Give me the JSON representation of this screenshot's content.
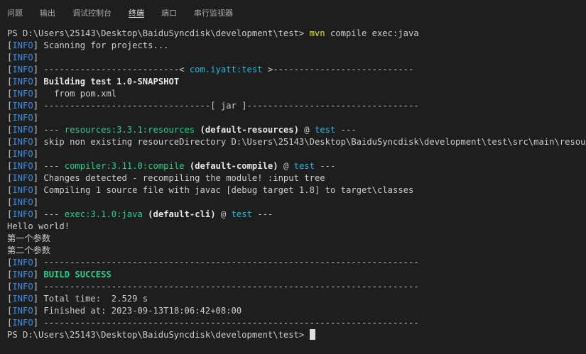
{
  "tabs": [
    {
      "label": "问题",
      "active": false
    },
    {
      "label": "输出",
      "active": false
    },
    {
      "label": "调试控制台",
      "active": false
    },
    {
      "label": "终端",
      "active": true
    },
    {
      "label": "端口",
      "active": false
    },
    {
      "label": "串行监视器",
      "active": false
    }
  ],
  "terminal": {
    "lines": [
      {
        "segments": [
          {
            "t": "PS D:\\Users\\25143\\Desktop\\BaiduSyncdisk\\development\\test> ",
            "c": ""
          },
          {
            "t": "mvn",
            "c": "yellow"
          },
          {
            "t": " compile exec:java",
            "c": ""
          }
        ]
      },
      {
        "info": true,
        "segments": [
          {
            "t": "Scanning for projects...",
            "c": ""
          }
        ]
      },
      {
        "info": true,
        "segments": []
      },
      {
        "info": true,
        "segments": [
          {
            "t": "--------------------------< ",
            "c": ""
          },
          {
            "t": "com.iyatt:test",
            "c": "cyan"
          },
          {
            "t": " >---------------------------",
            "c": ""
          }
        ]
      },
      {
        "info": true,
        "segments": [
          {
            "t": "Building test 1.0-SNAPSHOT",
            "c": "bold"
          }
        ]
      },
      {
        "info": true,
        "segments": [
          {
            "t": "  from pom.xml",
            "c": ""
          }
        ]
      },
      {
        "info": true,
        "segments": [
          {
            "t": "--------------------------------[ jar ]---------------------------------",
            "c": ""
          }
        ]
      },
      {
        "info": true,
        "segments": []
      },
      {
        "info": true,
        "segments": [
          {
            "t": "--- ",
            "c": ""
          },
          {
            "t": "resources:3.3.1:resources",
            "c": "green"
          },
          {
            "t": " ",
            "c": ""
          },
          {
            "t": "(default-resources)",
            "c": "bold"
          },
          {
            "t": " @ ",
            "c": ""
          },
          {
            "t": "test",
            "c": "cyan"
          },
          {
            "t": " ---",
            "c": ""
          }
        ]
      },
      {
        "info": true,
        "segments": [
          {
            "t": "skip non existing resourceDirectory D:\\Users\\25143\\Desktop\\BaiduSyncdisk\\development\\test\\src\\main\\resources",
            "c": ""
          }
        ]
      },
      {
        "info": true,
        "segments": []
      },
      {
        "info": true,
        "segments": [
          {
            "t": "--- ",
            "c": ""
          },
          {
            "t": "compiler:3.11.0:compile",
            "c": "green"
          },
          {
            "t": " ",
            "c": ""
          },
          {
            "t": "(default-compile)",
            "c": "bold"
          },
          {
            "t": " @ ",
            "c": ""
          },
          {
            "t": "test",
            "c": "cyan"
          },
          {
            "t": " ---",
            "c": ""
          }
        ]
      },
      {
        "info": true,
        "segments": [
          {
            "t": "Changes detected - recompiling the module! :input tree",
            "c": ""
          }
        ]
      },
      {
        "info": true,
        "segments": [
          {
            "t": "Compiling 1 source file with javac [debug target 1.8] to target\\classes",
            "c": ""
          }
        ]
      },
      {
        "info": true,
        "segments": []
      },
      {
        "info": true,
        "segments": [
          {
            "t": "--- ",
            "c": ""
          },
          {
            "t": "exec:3.1.0:java",
            "c": "green"
          },
          {
            "t": " ",
            "c": ""
          },
          {
            "t": "(default-cli)",
            "c": "bold"
          },
          {
            "t": " @ ",
            "c": ""
          },
          {
            "t": "test",
            "c": "cyan"
          },
          {
            "t": " ---",
            "c": ""
          }
        ]
      },
      {
        "segments": [
          {
            "t": "Hello world!",
            "c": ""
          }
        ]
      },
      {
        "segments": [
          {
            "t": "第一个参数",
            "c": ""
          }
        ]
      },
      {
        "segments": [
          {
            "t": "第二个参数",
            "c": ""
          }
        ]
      },
      {
        "info": true,
        "segments": [
          {
            "t": "------------------------------------------------------------------------",
            "c": ""
          }
        ]
      },
      {
        "info": true,
        "segments": [
          {
            "t": "BUILD SUCCESS",
            "c": "bold-green"
          }
        ]
      },
      {
        "info": true,
        "segments": [
          {
            "t": "------------------------------------------------------------------------",
            "c": ""
          }
        ]
      },
      {
        "info": true,
        "segments": [
          {
            "t": "Total time:  2.529 s",
            "c": ""
          }
        ]
      },
      {
        "info": true,
        "segments": [
          {
            "t": "Finished at: 2023-09-13T18:06:42+08:00",
            "c": ""
          }
        ]
      },
      {
        "info": true,
        "segments": [
          {
            "t": "------------------------------------------------------------------------",
            "c": ""
          }
        ]
      },
      {
        "segments": [
          {
            "t": "PS D:\\Users\\25143\\Desktop\\BaiduSyncdisk\\development\\test> ",
            "c": ""
          }
        ],
        "cursor": true
      }
    ],
    "info_label": "INFO"
  },
  "colors": {
    "background": "#1e1e1e",
    "text": "#cccccc",
    "info": "#3b8eea",
    "cyan": "#29b8db",
    "green": "#23d18b",
    "yellow": "#e5e510"
  }
}
